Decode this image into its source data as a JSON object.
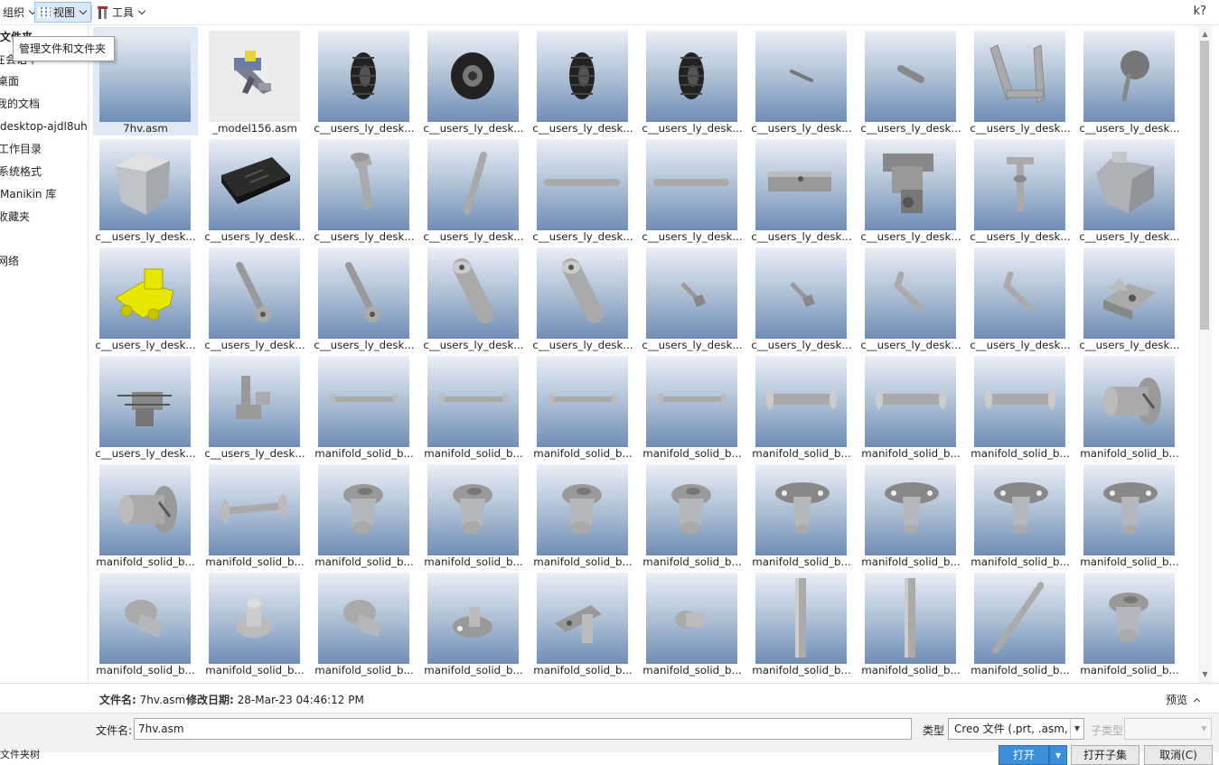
{
  "toolbar": {
    "organize": "组织",
    "view": "视图",
    "tools": "工具",
    "help": "k?"
  },
  "tooltip": "管理文件和文件夹",
  "sidebar": {
    "items": [
      {
        "label": "文件夹"
      },
      {
        "label": "在会话中"
      },
      {
        "label": "桌面"
      },
      {
        "label": "我的文档"
      },
      {
        "label": "desktop-ajdl8uh"
      },
      {
        "label": "工作目录"
      },
      {
        "label": "系统格式"
      },
      {
        "label": "Manikin 库"
      },
      {
        "label": "收藏夹"
      },
      {
        "label": "网络"
      }
    ]
  },
  "files": [
    {
      "name": "7hv.asm",
      "icon": "blank"
    },
    {
      "name": "_model156.asm",
      "icon": "assembly-icon"
    },
    {
      "name": "c__users_ly_desk...",
      "icon": "tire-icon"
    },
    {
      "name": "c__users_ly_desk...",
      "icon": "wheel-icon"
    },
    {
      "name": "c__users_ly_desk...",
      "icon": "tire-icon"
    },
    {
      "name": "c__users_ly_desk...",
      "icon": "tire-icon"
    },
    {
      "name": "c__users_ly_desk...",
      "icon": "pin-icon"
    },
    {
      "name": "c__users_ly_desk...",
      "icon": "short-pin-icon"
    },
    {
      "name": "c__users_ly_desk...",
      "icon": "u-frame-icon"
    },
    {
      "name": "c__users_ly_desk...",
      "icon": "knob-icon"
    },
    {
      "name": "c__users_ly_desk...",
      "icon": "hopper-icon"
    },
    {
      "name": "c__users_ly_desk...",
      "icon": "board-icon"
    },
    {
      "name": "c__users_ly_desk...",
      "icon": "bolt-icon"
    },
    {
      "name": "c__users_ly_desk...",
      "icon": "shaft-icon"
    },
    {
      "name": "c__users_ly_desk...",
      "icon": "rod-icon"
    },
    {
      "name": "c__users_ly_desk...",
      "icon": "rod-icon"
    },
    {
      "name": "c__users_ly_desk...",
      "icon": "bar-icon"
    },
    {
      "name": "c__users_ly_desk...",
      "icon": "mechanism-icon"
    },
    {
      "name": "c__users_ly_desk...",
      "icon": "t-bolt-icon"
    },
    {
      "name": "c__users_ly_desk...",
      "icon": "block-icon"
    },
    {
      "name": "c__users_ly_desk...",
      "icon": "vehicle-icon"
    },
    {
      "name": "c__users_ly_desk...",
      "icon": "link-icon"
    },
    {
      "name": "c__users_ly_desk...",
      "icon": "link-icon"
    },
    {
      "name": "c__users_ly_desk...",
      "icon": "cylinder-icon"
    },
    {
      "name": "c__users_ly_desk...",
      "icon": "cylinder-icon"
    },
    {
      "name": "c__users_ly_desk...",
      "icon": "small-bolt-icon"
    },
    {
      "name": "c__users_ly_desk...",
      "icon": "small-bolt-icon"
    },
    {
      "name": "c__users_ly_desk...",
      "icon": "hook-icon"
    },
    {
      "name": "c__users_ly_desk...",
      "icon": "hook-icon"
    },
    {
      "name": "c__users_ly_desk...",
      "icon": "clamp-icon"
    },
    {
      "name": "c__users_ly_desk...",
      "icon": "fixture-icon"
    },
    {
      "name": "c__users_ly_desk...",
      "icon": "bracket-icon"
    },
    {
      "name": "manifold_solid_b...",
      "icon": "thin-axle-icon"
    },
    {
      "name": "manifold_solid_b...",
      "icon": "thin-axle-icon"
    },
    {
      "name": "manifold_solid_b...",
      "icon": "thin-axle-icon"
    },
    {
      "name": "manifold_solid_b...",
      "icon": "thin-axle-icon"
    },
    {
      "name": "manifold_solid_b...",
      "icon": "axle-icon"
    },
    {
      "name": "manifold_solid_b...",
      "icon": "axle-icon"
    },
    {
      "name": "manifold_solid_b...",
      "icon": "axle-icon"
    },
    {
      "name": "manifold_solid_b...",
      "icon": "big-screw-icon"
    },
    {
      "name": "manifold_solid_b...",
      "icon": "big-screw-icon"
    },
    {
      "name": "manifold_solid_b...",
      "icon": "spool-icon"
    },
    {
      "name": "manifold_solid_b...",
      "icon": "flange-pin-icon"
    },
    {
      "name": "manifold_solid_b...",
      "icon": "flange-pin-icon"
    },
    {
      "name": "manifold_solid_b...",
      "icon": "flange-pin-icon"
    },
    {
      "name": "manifold_solid_b...",
      "icon": "flange-pin-icon"
    },
    {
      "name": "manifold_solid_b...",
      "icon": "oval-flange-icon"
    },
    {
      "name": "manifold_solid_b...",
      "icon": "oval-flange-icon"
    },
    {
      "name": "manifold_solid_b...",
      "icon": "oval-flange-icon"
    },
    {
      "name": "manifold_solid_b...",
      "icon": "oval-flange-icon"
    },
    {
      "name": "manifold_solid_b...",
      "icon": "plug-icon"
    },
    {
      "name": "manifold_solid_b...",
      "icon": "stud-icon"
    },
    {
      "name": "manifold_solid_b...",
      "icon": "plug-icon"
    },
    {
      "name": "manifold_solid_b...",
      "icon": "tab-pin-icon"
    },
    {
      "name": "manifold_solid_b...",
      "icon": "angle-pin-icon"
    },
    {
      "name": "manifold_solid_b...",
      "icon": "small-plug-icon"
    },
    {
      "name": "manifold_solid_b...",
      "icon": "flat-bar-icon"
    },
    {
      "name": "manifold_solid_b...",
      "icon": "flat-bar-icon"
    },
    {
      "name": "manifold_solid_b...",
      "icon": "diag-rod-icon"
    },
    {
      "name": "manifold_solid_b...",
      "icon": "flange-pin-icon"
    }
  ],
  "details": {
    "file_name_label": "文件名:",
    "file_name": "7hv.asm",
    "modified_label": "修改日期:",
    "modified": "28-Mar-23 04:46:12 PM",
    "preview": "预览"
  },
  "bottom": {
    "file_name_label": "文件名:",
    "file_name_value": "7hv.asm",
    "type_label": "类型",
    "type_value": "Creo 文件 (.prt, .asm,",
    "subtype_label": "子类型",
    "open": "打开",
    "open_sub": "打开子集",
    "cancel": "取消(C)",
    "footer": "文件夹树"
  }
}
